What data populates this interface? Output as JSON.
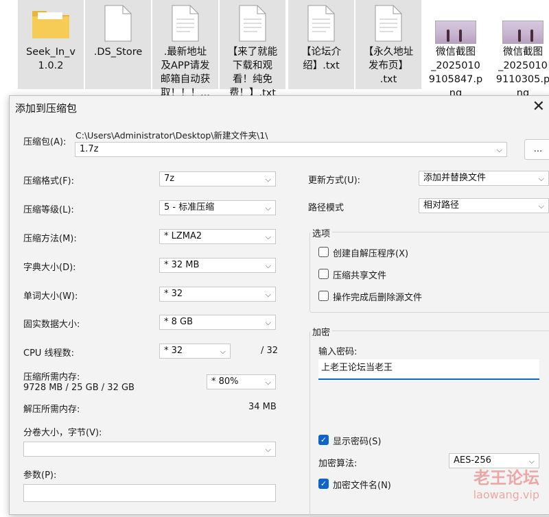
{
  "explorer": {
    "files": [
      {
        "name": "Seek_In_v\n1.0.2",
        "icon": "folder-icon"
      },
      {
        "name": ".DS_Store",
        "icon": "file-icon"
      },
      {
        "name": ".最新地址\n及APP请发\n邮箱自动获\n取！！！...",
        "icon": "file-icon"
      },
      {
        "name": "【来了就能\n下载和观\n看！纯免\n费！】.txt",
        "icon": "file-icon"
      },
      {
        "name": "【论坛介\n绍】.txt",
        "icon": "file-icon"
      },
      {
        "name": "【永久地址\n发布页】\n.txt",
        "icon": "file-icon"
      },
      {
        "name": "微信截图\n_2025010\n9105847.p\nng",
        "icon": "image-thumbnail"
      },
      {
        "name": "微信截图\n_2025010\n9110305.p\nng",
        "icon": "image-thumbnail"
      }
    ]
  },
  "dialog": {
    "title": "添加到压缩包",
    "archive_label": "压缩包(A):",
    "archive_path": "C:\\Users\\Administrator\\Desktop\\新建文件夹\\1\\",
    "archive_name": "1.7z",
    "browse_label": "...",
    "format_label": "压缩格式(F):",
    "format_value": "7z",
    "level_label": "压缩等级(L):",
    "level_value": "5 - 标准压缩",
    "method_label": "压缩方法(M):",
    "method_value": "*  LZMA2",
    "dict_label": "字典大小(D):",
    "dict_value": "*  32 MB",
    "word_label": "单词大小(W):",
    "word_value": "*  32",
    "solid_label": "固实数据大小:",
    "solid_value": "*  8 GB",
    "cpu_label": "CPU 线程数:",
    "cpu_value": "*  32",
    "cpu_total": "/ 32",
    "mem_label": "压缩所需内存:",
    "mem_value": "9728 MB / 25 GB / 32 GB",
    "mem_percent": "*  80%",
    "decomp_label": "解压所需内存:",
    "decomp_value": "34 MB",
    "split_label": "分卷大小，字节(V):",
    "split_value": "",
    "params_label": "参数(P):",
    "params_value": "",
    "update_label": "更新方式(U):",
    "update_value": "添加并替换文件",
    "path_label": "路径模式",
    "path_value": "相对路径",
    "options_title": "选项",
    "opt_sfx": "创建自解压程序(X)",
    "opt_shared": "压缩共享文件",
    "opt_delete": "操作完成后删除源文件",
    "encrypt_title": "加密",
    "pwd_label": "输入密码:",
    "pwd_value": "上老王论坛当老王",
    "show_pwd": "显示密码(S)",
    "enc_method_label": "加密算法:",
    "enc_method_value": "AES-256",
    "enc_names": "加密文件名(N)"
  },
  "watermark": {
    "line1": "老王论坛",
    "line2": "laowang.vip"
  }
}
